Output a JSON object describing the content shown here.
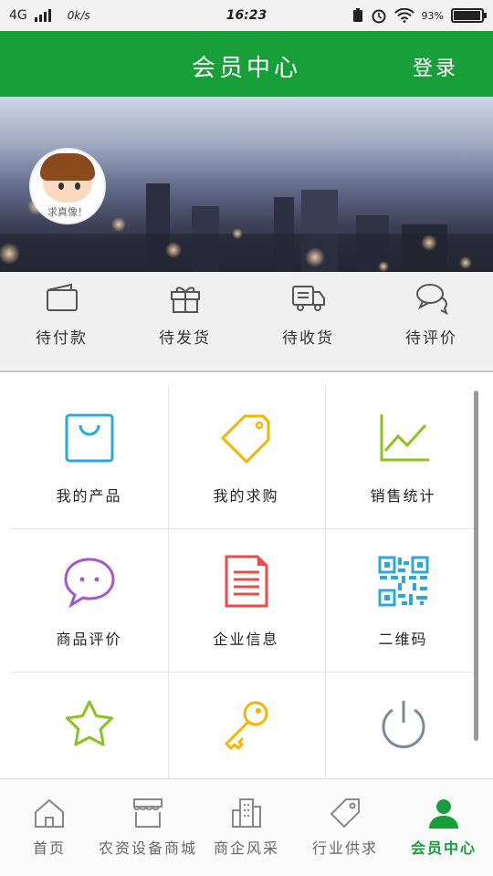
{
  "status_bar": {
    "network": "4G",
    "speed": "0k/s",
    "time": "16:23",
    "battery": "93%"
  },
  "header": {
    "title": "会员中心",
    "login": "登录"
  },
  "banner": {
    "avatar_caption": "求真像！"
  },
  "orders": [
    {
      "label": "待付款",
      "icon": "wallet-icon"
    },
    {
      "label": "待发货",
      "icon": "gift-icon"
    },
    {
      "label": "待收货",
      "icon": "truck-icon"
    },
    {
      "label": "待评价",
      "icon": "chat-icon"
    }
  ],
  "grid": [
    {
      "label": "我的产品",
      "icon": "shopping-bag-icon",
      "color": "#29a8e0"
    },
    {
      "label": "我的求购",
      "icon": "tag-icon",
      "color": "#f5b400"
    },
    {
      "label": "销售统计",
      "icon": "line-chart-icon",
      "color": "#8bc31c"
    },
    {
      "label": "商品评价",
      "icon": "speech-bubble-icon",
      "color": "#a45ac6"
    },
    {
      "label": "企业信息",
      "icon": "document-icon",
      "color": "#ef4a4a"
    },
    {
      "label": "二维码",
      "icon": "qr-code-icon",
      "color": "#29a8e0"
    },
    {
      "label": "",
      "icon": "star-icon",
      "color": "#8bc31c"
    },
    {
      "label": "",
      "icon": "key-icon",
      "color": "#f5b400"
    },
    {
      "label": "",
      "icon": "power-icon",
      "color": "#7a8a99"
    }
  ],
  "tabbar": [
    {
      "label": "首页",
      "icon": "home-icon"
    },
    {
      "label": "农资设备商城",
      "icon": "store-icon"
    },
    {
      "label": "商企风采",
      "icon": "buildings-icon"
    },
    {
      "label": "行业供求",
      "icon": "price-tag-icon"
    },
    {
      "label": "会员中心",
      "icon": "person-icon",
      "active": true
    }
  ],
  "colors": {
    "brand": "#17a03a"
  }
}
